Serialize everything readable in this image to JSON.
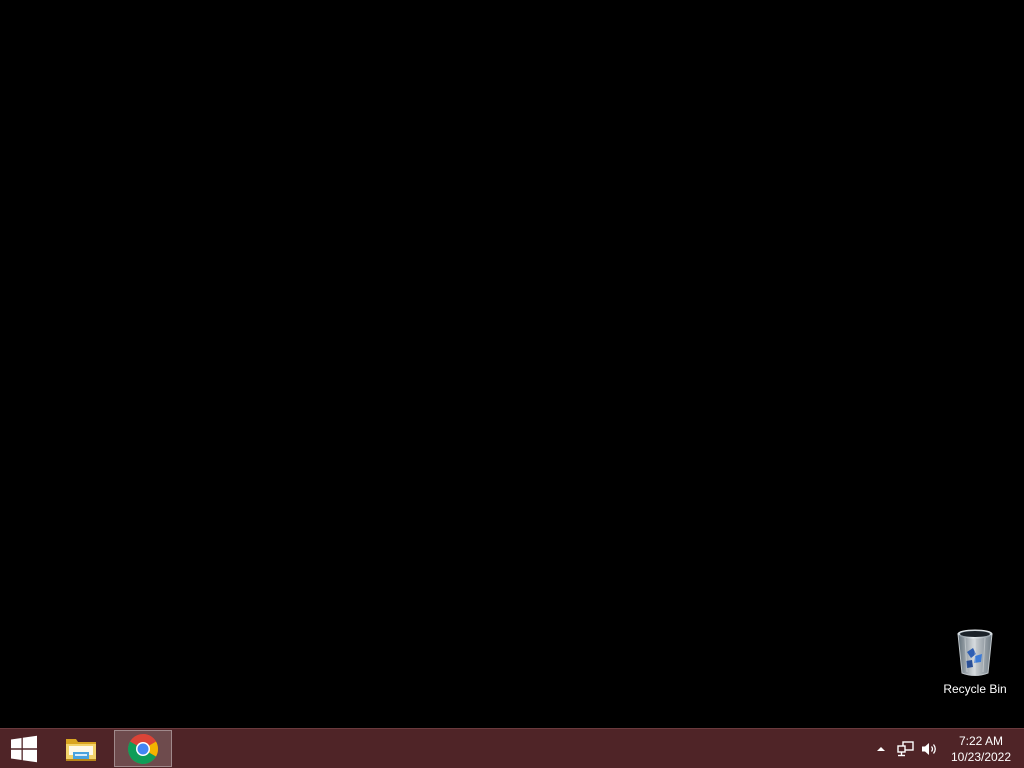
{
  "desktop": {
    "background_color": "#000000",
    "icons": [
      {
        "label": "Recycle Bin",
        "icon": "recycle-bin-icon"
      }
    ]
  },
  "taskbar": {
    "background_color": "#4f2427",
    "start": {
      "icon": "windows-logo-icon"
    },
    "apps": [
      {
        "name": "File Explorer",
        "icon": "file-explorer-icon",
        "active": false
      },
      {
        "name": "Google Chrome",
        "icon": "chrome-icon",
        "active": true
      }
    ],
    "tray": {
      "icons": [
        "show-hidden-icons-chevron",
        "network-icon",
        "volume-icon"
      ]
    },
    "clock": {
      "time": "7:22 AM",
      "date": "10/23/2022"
    }
  }
}
